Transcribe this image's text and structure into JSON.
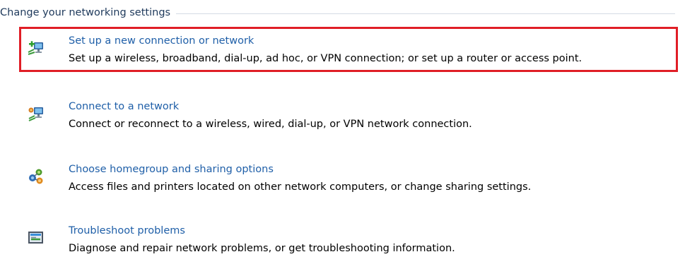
{
  "section": {
    "title": "Change your networking settings"
  },
  "tasks": [
    {
      "link": "Set up a new connection or network",
      "description": "Set up a wireless, broadband, dial-up, ad hoc, or VPN connection; or set up a router or access point.",
      "icon": "new-connection-icon"
    },
    {
      "link": "Connect to a network",
      "description": "Connect or reconnect to a wireless, wired, dial-up, or VPN network connection.",
      "icon": "connect-network-icon"
    },
    {
      "link": "Choose homegroup and sharing options",
      "description": "Access files and printers located on other network computers, or change sharing settings.",
      "icon": "homegroup-icon"
    },
    {
      "link": "Troubleshoot problems",
      "description": "Diagnose and repair network problems, or get troubleshooting information.",
      "icon": "troubleshoot-icon"
    }
  ],
  "highlight": {
    "color": "#e01e26"
  },
  "colors": {
    "link": "#1f5fa8",
    "heading": "#1e395b",
    "text": "#000000"
  }
}
